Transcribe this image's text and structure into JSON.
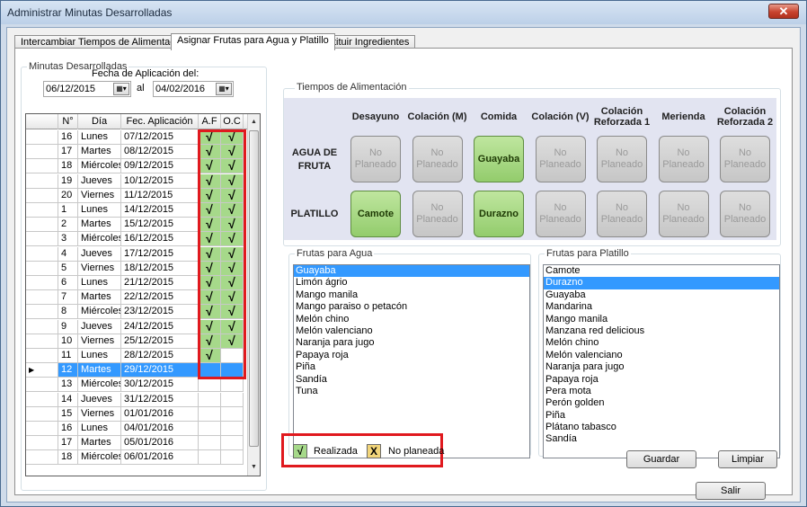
{
  "window": {
    "title": "Administrar Minutas Desarrolladas",
    "close_glyph": "✕"
  },
  "tabs": [
    {
      "label": "Intercambiar Tiempos de Alimentación"
    },
    {
      "label": "Asignar Frutas para Agua y Platillo"
    },
    {
      "label": "Sustituir Ingredientes"
    }
  ],
  "minutas": {
    "group_title": "Minutas Desarrolladas",
    "fecha_label": "Fecha de Aplicación del:",
    "from_date": "06/12/2015",
    "al_label": "al",
    "to_date": "04/02/2016",
    "columns": [
      "N°",
      "Día",
      "Fec. Aplicación",
      "A.F",
      "O.C"
    ],
    "check_glyph": "√",
    "rows": [
      {
        "n": "16",
        "dia": "Lunes",
        "fecha": "07/12/2015",
        "af": true,
        "oc": true
      },
      {
        "n": "17",
        "dia": "Martes",
        "fecha": "08/12/2015",
        "af": true,
        "oc": true
      },
      {
        "n": "18",
        "dia": "Miércoles",
        "fecha": "09/12/2015",
        "af": true,
        "oc": true
      },
      {
        "n": "19",
        "dia": "Jueves",
        "fecha": "10/12/2015",
        "af": true,
        "oc": true
      },
      {
        "n": "20",
        "dia": "Viernes",
        "fecha": "11/12/2015",
        "af": true,
        "oc": true
      },
      {
        "n": "1",
        "dia": "Lunes",
        "fecha": "14/12/2015",
        "af": true,
        "oc": true
      },
      {
        "n": "2",
        "dia": "Martes",
        "fecha": "15/12/2015",
        "af": true,
        "oc": true
      },
      {
        "n": "3",
        "dia": "Miércoles",
        "fecha": "16/12/2015",
        "af": true,
        "oc": true
      },
      {
        "n": "4",
        "dia": "Jueves",
        "fecha": "17/12/2015",
        "af": true,
        "oc": true
      },
      {
        "n": "5",
        "dia": "Viernes",
        "fecha": "18/12/2015",
        "af": true,
        "oc": true
      },
      {
        "n": "6",
        "dia": "Lunes",
        "fecha": "21/12/2015",
        "af": true,
        "oc": true
      },
      {
        "n": "7",
        "dia": "Martes",
        "fecha": "22/12/2015",
        "af": true,
        "oc": true
      },
      {
        "n": "8",
        "dia": "Miércoles",
        "fecha": "23/12/2015",
        "af": true,
        "oc": true
      },
      {
        "n": "9",
        "dia": "Jueves",
        "fecha": "24/12/2015",
        "af": true,
        "oc": true
      },
      {
        "n": "10",
        "dia": "Viernes",
        "fecha": "25/12/2015",
        "af": true,
        "oc": true
      },
      {
        "n": "11",
        "dia": "Lunes",
        "fecha": "28/12/2015",
        "af": true,
        "oc": false
      },
      {
        "n": "12",
        "dia": "Martes",
        "fecha": "29/12/2015",
        "af": false,
        "oc": false,
        "selected": true
      },
      {
        "n": "13",
        "dia": "Miércoles",
        "fecha": "30/12/2015",
        "af": false,
        "oc": false
      },
      {
        "n": "14",
        "dia": "Jueves",
        "fecha": "31/12/2015",
        "af": false,
        "oc": false
      },
      {
        "n": "15",
        "dia": "Viernes",
        "fecha": "01/01/2016",
        "af": false,
        "oc": false
      },
      {
        "n": "16",
        "dia": "Lunes",
        "fecha": "04/01/2016",
        "af": false,
        "oc": false
      },
      {
        "n": "17",
        "dia": "Martes",
        "fecha": "05/01/2016",
        "af": false,
        "oc": false
      },
      {
        "n": "18",
        "dia": "Miércoles",
        "fecha": "06/01/2016",
        "af": false,
        "oc": false
      }
    ]
  },
  "tiempos": {
    "group_title": "Tiempos de Alimentación",
    "columns": [
      "Desayuno",
      "Colación (M)",
      "Comida",
      "Colación (V)",
      "Colación Reforzada 1",
      "Merienda",
      "Colación Reforzada 2"
    ],
    "rows": [
      {
        "label": "AGUA DE FRUTA",
        "cells": [
          "No Planeado",
          "No Planeado",
          "Guayaba",
          "No Planeado",
          "No Planeado",
          "No Planeado",
          "No Planeado"
        ]
      },
      {
        "label": "PLATILLO",
        "cells": [
          "Camote",
          "No Planeado",
          "Durazno",
          "No Planeado",
          "No Planeado",
          "No Planeado",
          "No Planeado"
        ]
      }
    ],
    "placeholder": "No Planeado"
  },
  "frutas_agua": {
    "group_title": "Frutas para Agua",
    "selected": "Guayaba",
    "items": [
      "Guayaba",
      "Limón ágrio",
      "Mango manila",
      "Mango paraiso o petacón",
      "Melón chino",
      "Melón valenciano",
      "Naranja para jugo",
      "Papaya roja",
      "Piña",
      "Sandía",
      "Tuna"
    ]
  },
  "frutas_platillo": {
    "group_title": "Frutas para Platillo",
    "selected": "Durazno",
    "items": [
      "Camote",
      "Durazno",
      "Guayaba",
      "Mandarina",
      "Mango manila",
      "Manzana red delicious",
      "Melón chino",
      "Melón valenciano",
      "Naranja para jugo",
      "Papaya roja",
      "Pera mota",
      "Perón golden",
      "Piña",
      "Plátano tabasco",
      "Sandía"
    ]
  },
  "legend": {
    "realizada_glyph": "√",
    "realizada_label": "Realizada",
    "no_planeada_glyph": "X",
    "no_planeada_label": "No planeada"
  },
  "buttons": {
    "guardar": "Guardar",
    "limpiar": "Limpiar",
    "salir": "Salir"
  },
  "colors": {
    "done_green": "#a6d98a",
    "warn_yellow": "#f2d57a",
    "highlight_red": "#e0191e",
    "selection_blue": "#3399ff"
  }
}
